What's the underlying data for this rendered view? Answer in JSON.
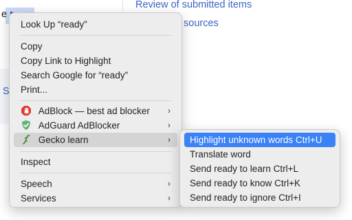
{
  "background": {
    "link_review": "Review of submitted items",
    "link_sources": "sources",
    "fragment_left": "e r",
    "fragment_s": "S"
  },
  "menu": {
    "lookup": "Look Up “ready”",
    "copy": "Copy",
    "copy_link": "Copy Link to Highlight",
    "search_google": "Search Google for “ready”",
    "print": "Print...",
    "adblock": "AdBlock — best ad blocker",
    "adguard": "AdGuard AdBlocker",
    "gecko": "Gecko learn",
    "inspect": "Inspect",
    "speech": "Speech",
    "services": "Services",
    "chevron": "›"
  },
  "submenu": {
    "highlight": "Highlight unknown words Ctrl+U",
    "translate": "Translate word",
    "send_learn": "Send ready to learn Ctrl+L",
    "send_know": "Send ready to know Ctrl+K",
    "send_ignore": "Send ready to ignore Ctrl+I"
  },
  "colors": {
    "highlight": "#3b82f6",
    "adblock_red": "#e5382f",
    "adguard_green": "#67b279",
    "gecko_green": "#3c8a3c"
  },
  "icons": {
    "adblock": "stop-hand-icon",
    "adguard": "shield-check-icon",
    "gecko": "gecko-icon"
  }
}
